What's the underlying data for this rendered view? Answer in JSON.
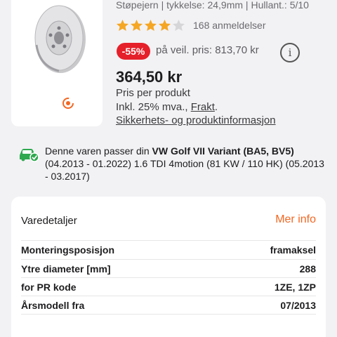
{
  "product": {
    "specs_line": "Støpejern | tykkelse: 24,9mm | Hullant.: 5/10",
    "rating_stars": 4,
    "rating_max": 5,
    "review_count": "168 anmeldelser",
    "discount": "-55%",
    "original_price": "på veil. pris: 813,70 kr",
    "info_label": "i",
    "price": "364,50 kr",
    "price_per": "Pris per produkt",
    "vat_text": "Inkl. 25% mva., ",
    "freight_link": "Frakt",
    "vat_suffix": ".",
    "safety_link": "Sikkerhets- og produktinformasjon"
  },
  "fitment": {
    "prefix": "Denne varen passer din ",
    "vehicle": "VW Golf VII Variant (BA5, BV5)",
    "detail": "(04.2013 - 01.2022) 1.6 TDI 4motion (81 KW / 110 HK) (05.2013 - 03.2017)"
  },
  "details": {
    "title": "Varedetaljer",
    "more_label": "Mer info",
    "rows": [
      {
        "label": "Monteringsposisjon",
        "value": "framaksel"
      },
      {
        "label": "Ytre diameter [mm]",
        "value": "288"
      },
      {
        "label": "for PR kode",
        "value": "1ZE, 1ZP"
      },
      {
        "label": "Årsmodell fra",
        "value": "07/2013"
      }
    ]
  },
  "colors": {
    "accent": "#f26722",
    "star": "#f5a623",
    "discount": "#e5202a",
    "fit_green": "#2fa84f"
  },
  "icons": {
    "stars": "star-icon",
    "info": "info-icon",
    "car": "car-check-icon",
    "rotate": "rotate-360-icon"
  }
}
